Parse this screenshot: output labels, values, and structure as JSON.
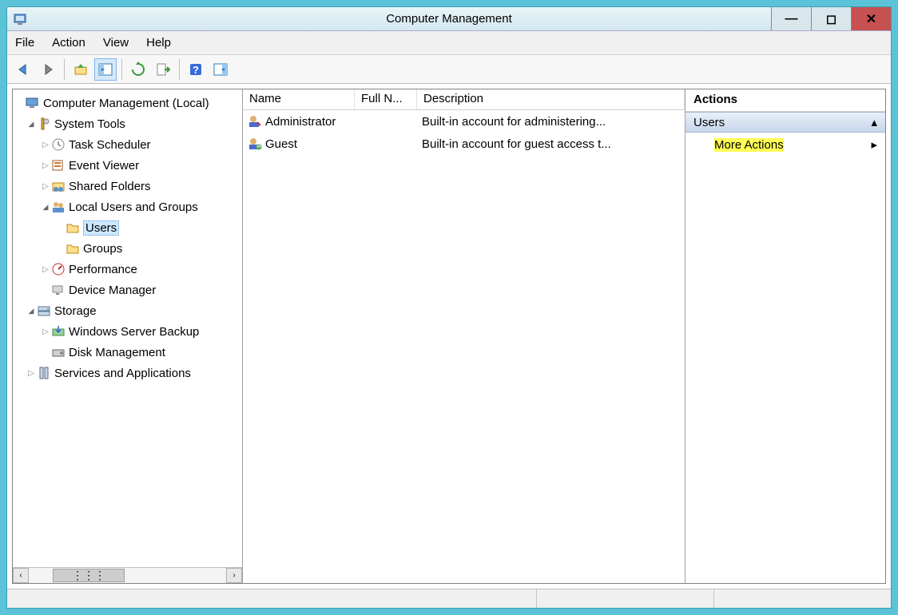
{
  "window": {
    "title": "Computer Management"
  },
  "menu": {
    "file": "File",
    "action": "Action",
    "view": "View",
    "help": "Help"
  },
  "toolbar": {
    "back": "back-icon",
    "forward": "forward-icon",
    "up": "up-icon",
    "show_hide": "show-hide-tree-icon",
    "refresh": "refresh-icon",
    "export": "export-list-icon",
    "help": "help-icon",
    "show_actions": "show-actions-icon"
  },
  "tree": {
    "root": "Computer Management (Local)",
    "system_tools": "System Tools",
    "task_scheduler": "Task Scheduler",
    "event_viewer": "Event Viewer",
    "shared_folders": "Shared Folders",
    "local_users_groups": "Local Users and Groups",
    "users": "Users",
    "groups": "Groups",
    "performance": "Performance",
    "device_manager": "Device Manager",
    "storage": "Storage",
    "wsb": "Windows Server Backup",
    "disk_mgmt": "Disk Management",
    "services_apps": "Services and Applications"
  },
  "list": {
    "columns": {
      "name": "Name",
      "full_name": "Full N...",
      "description": "Description"
    },
    "rows": [
      {
        "name": "Administrator",
        "full_name": "",
        "description": "Built-in account for administering..."
      },
      {
        "name": "Guest",
        "full_name": "",
        "description": "Built-in account for guest access t..."
      }
    ]
  },
  "actions": {
    "header": "Actions",
    "group": "Users",
    "more": "More Actions"
  }
}
